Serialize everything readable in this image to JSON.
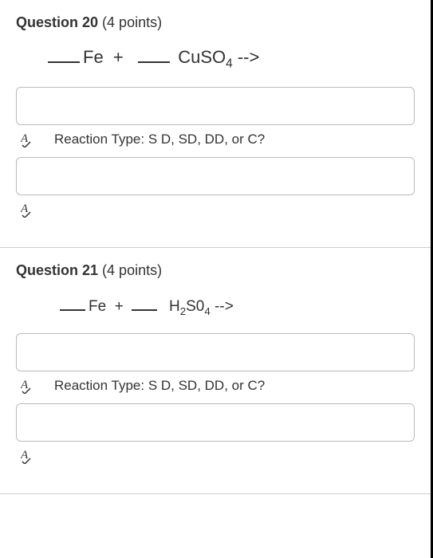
{
  "questions": [
    {
      "number": "Question 20",
      "points": "(4 points)",
      "equation_parts": {
        "reagent1": "Fe",
        "plus": "+",
        "reagent2_prefix": "CuSO",
        "reagent2_sub": "4",
        "arrow": "-->"
      },
      "prompt": "Reaction Type: S D, SD, DD, or C?",
      "input1_value": "",
      "input2_value": ""
    },
    {
      "number": "Question 21",
      "points": "(4 points)",
      "equation_parts": {
        "reagent1": "Fe",
        "plus": "+",
        "reagent2_a": "H",
        "reagent2_a_sub": "2",
        "reagent2_b": "S0",
        "reagent2_b_sub": "4",
        "arrow": "-->"
      },
      "prompt": "Reaction Type: S D, SD, DD, or C?",
      "input1_value": "",
      "input2_value": ""
    }
  ]
}
